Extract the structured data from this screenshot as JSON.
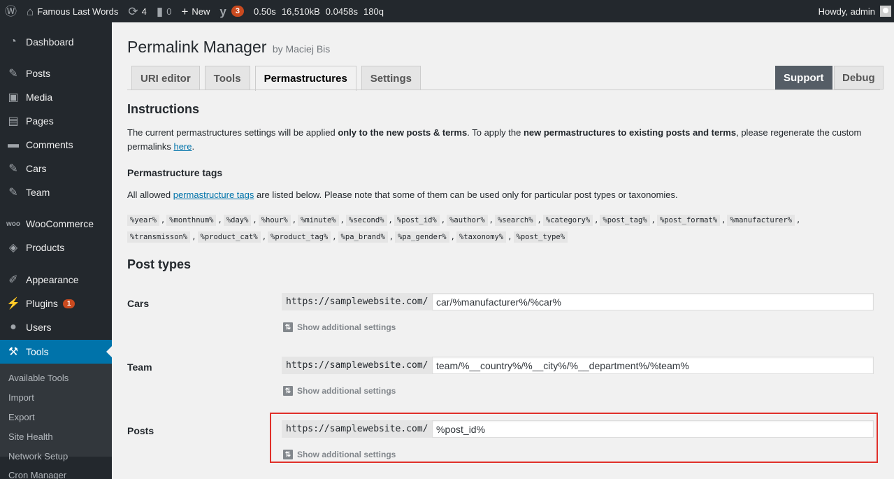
{
  "adminbar": {
    "site_name": "Famous Last Words",
    "updates_count": "4",
    "comments_count": "0",
    "new_label": "New",
    "yoast_badge": "3",
    "stat_time": "0.50s",
    "stat_memory": "16,510kB",
    "stat_query_time": "0.0458s",
    "stat_queries": "180q",
    "greeting": "Howdy, admin"
  },
  "sidebar": {
    "items": [
      {
        "label": "Dashboard",
        "icon": "dashboard-icon"
      },
      {
        "label": "Posts",
        "icon": "pin-icon"
      },
      {
        "label": "Media",
        "icon": "media-icon"
      },
      {
        "label": "Pages",
        "icon": "pages-icon"
      },
      {
        "label": "Comments",
        "icon": "comment-icon"
      },
      {
        "label": "Cars",
        "icon": "pin-icon"
      },
      {
        "label": "Team",
        "icon": "pin-icon"
      },
      {
        "label": "WooCommerce",
        "icon": "woo-icon"
      },
      {
        "label": "Products",
        "icon": "box-icon"
      },
      {
        "label": "Appearance",
        "icon": "brush-icon"
      },
      {
        "label": "Plugins",
        "icon": "plug-icon",
        "badge": "1"
      },
      {
        "label": "Users",
        "icon": "user-icon"
      },
      {
        "label": "Tools",
        "icon": "wrench-icon"
      }
    ],
    "submenu": [
      "Available Tools",
      "Import",
      "Export",
      "Site Health",
      "Network Setup",
      "Cron Manager"
    ]
  },
  "main": {
    "title": "Permalink Manager",
    "by": "by Maciej Bis",
    "tabs": [
      "URI editor",
      "Tools",
      "Permastructures",
      "Settings"
    ],
    "support_label": "Support",
    "debug_label": "Debug",
    "instructions_heading": "Instructions",
    "instructions": {
      "p1": "The current permastructures settings will be applied ",
      "b1": "only to the new posts & terms",
      "p2": ". To apply the ",
      "b2": "new permastructures to existing posts and terms",
      "p3": ", please regenerate the custom permalinks ",
      "link": "here",
      "p4": "."
    },
    "tags_heading": "Permastructure tags",
    "tags_intro": {
      "p1": "All allowed ",
      "link": "permastructure tags",
      "p2": " are listed below. Please note that some of them can be used only for particular post types or taxonomies."
    },
    "tags": [
      "%year%",
      "%monthnum%",
      "%day%",
      "%hour%",
      "%minute%",
      "%second%",
      "%post_id%",
      "%author%",
      "%search%",
      "%category%",
      "%post_tag%",
      "%post_format%",
      "%manufacturer%",
      "%transmisson%",
      "%product_cat%",
      "%product_tag%",
      "%pa_brand%",
      "%pa_gender%",
      "%taxonomy%",
      "%post_type%"
    ],
    "post_types_heading": "Post types",
    "base_url": "https://samplewebsite.com/",
    "more_label": "Show additional settings",
    "post_types": [
      {
        "label": "Cars",
        "value": "car/%manufacturer%/%car%"
      },
      {
        "label": "Team",
        "value": "team/%__country%/%__city%/%__department%/%team%"
      },
      {
        "label": "Posts",
        "value": "%post_id%"
      }
    ]
  },
  "colors": {
    "accent": "#0073aa",
    "adminbar": "#23282d",
    "highlight": "#e0302a",
    "badge": "#ca4a1f"
  }
}
